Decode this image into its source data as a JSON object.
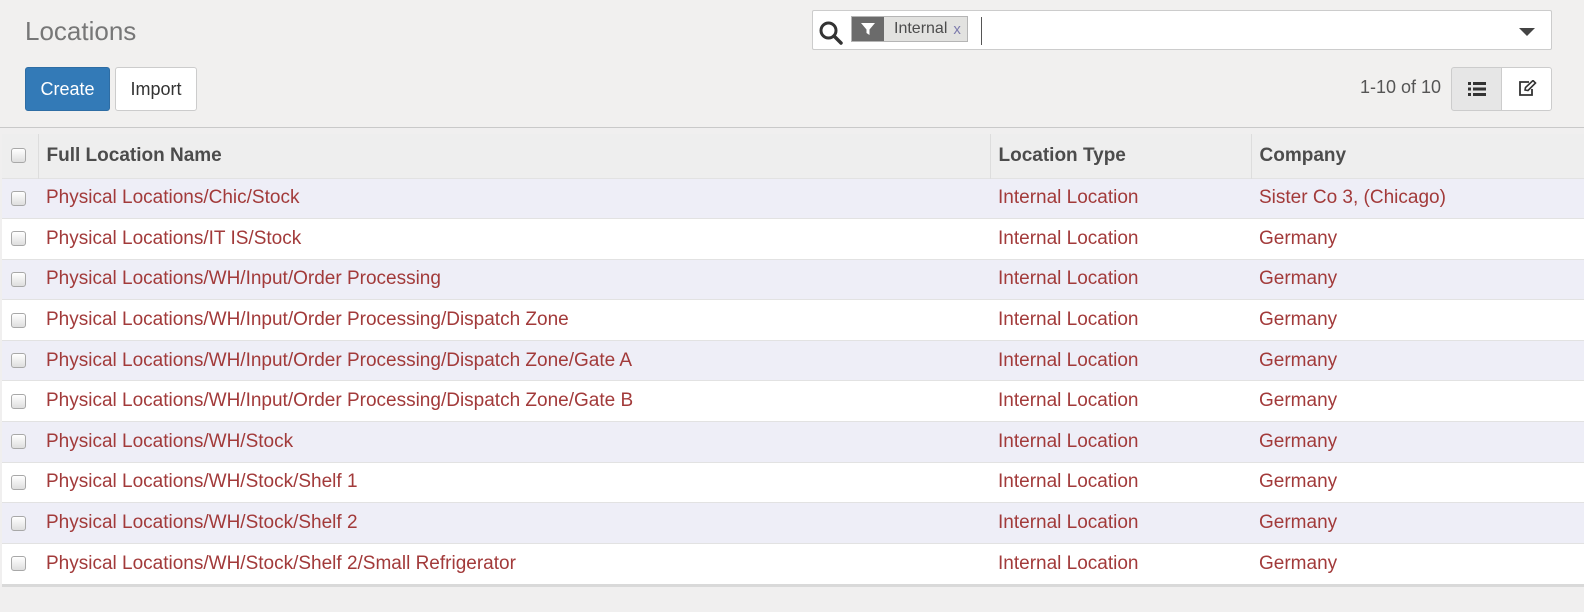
{
  "page": {
    "title": "Locations"
  },
  "toolbar": {
    "create_label": "Create",
    "import_label": "Import"
  },
  "search": {
    "facet_label": "Internal",
    "facet_remove": "x",
    "value": ""
  },
  "pager": {
    "value": "1-10 of 10"
  },
  "table": {
    "columns": [
      "Full Location Name",
      "Location Type",
      "Company"
    ],
    "rows": [
      {
        "name": "Physical Locations/Chic/Stock",
        "type": "Internal Location",
        "company": "Sister Co 3, (Chicago)"
      },
      {
        "name": "Physical Locations/IT IS/Stock",
        "type": "Internal Location",
        "company": "Germany"
      },
      {
        "name": "Physical Locations/WH/Input/Order Processing",
        "type": "Internal Location",
        "company": "Germany"
      },
      {
        "name": "Physical Locations/WH/Input/Order Processing/Dispatch Zone",
        "type": "Internal Location",
        "company": "Germany"
      },
      {
        "name": "Physical Locations/WH/Input/Order Processing/Dispatch Zone/Gate A",
        "type": "Internal Location",
        "company": "Germany"
      },
      {
        "name": "Physical Locations/WH/Input/Order Processing/Dispatch Zone/Gate B",
        "type": "Internal Location",
        "company": "Germany"
      },
      {
        "name": "Physical Locations/WH/Stock",
        "type": "Internal Location",
        "company": "Germany"
      },
      {
        "name": "Physical Locations/WH/Stock/Shelf 1",
        "type": "Internal Location",
        "company": "Germany"
      },
      {
        "name": "Physical Locations/WH/Stock/Shelf 2",
        "type": "Internal Location",
        "company": "Germany"
      },
      {
        "name": "Physical Locations/WH/Stock/Shelf 2/Small Refrigerator",
        "type": "Internal Location",
        "company": "Germany"
      }
    ]
  },
  "icons": {
    "search": "search-icon",
    "filter": "filter-icon",
    "dropdown": "caret-down-icon",
    "list_view": "list-view-icon",
    "form_view": "edit-icon"
  },
  "colors": {
    "primary": "#337ab7",
    "link": "#a23a3a",
    "odd_row": "#eeeef7"
  }
}
